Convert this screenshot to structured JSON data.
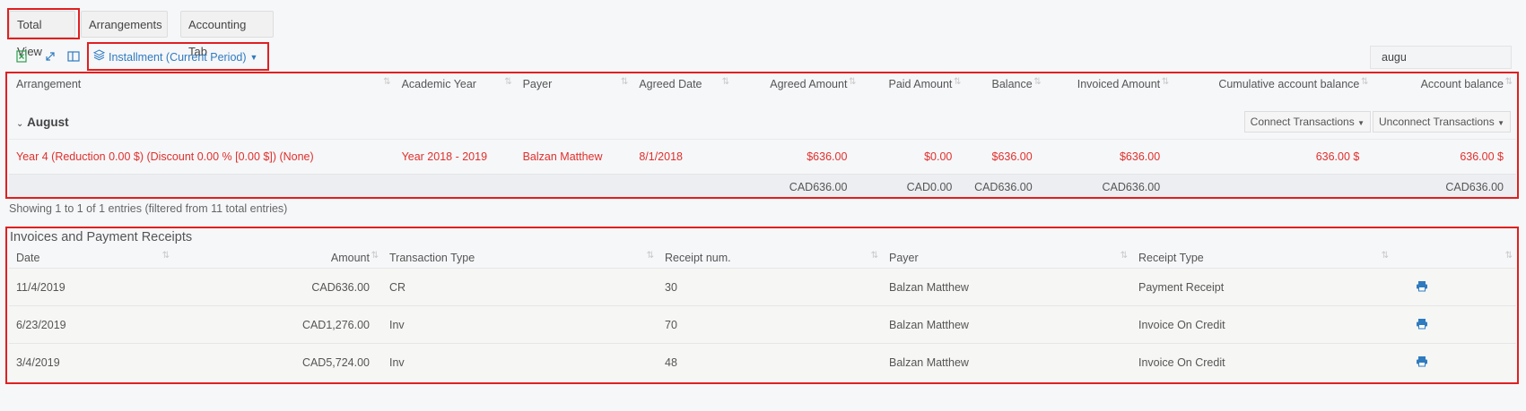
{
  "tabs": [
    {
      "label": "Total View"
    },
    {
      "label": "Arrangements"
    },
    {
      "label": "Accounting Tab"
    }
  ],
  "toolbar": {
    "excel_icon": "excel-icon",
    "expand_icon": "expand-icon",
    "columns_icon": "columns-icon",
    "view_select_label": "Installment (Current Period)"
  },
  "search": {
    "value": "augu"
  },
  "arrangements_table": {
    "headers": [
      "Arrangement",
      "Academic Year",
      "Payer",
      "Agreed Date",
      "Agreed Amount",
      "Paid Amount",
      "Balance",
      "Invoiced Amount",
      "Cumulative account balance",
      "Account balance"
    ],
    "group": {
      "label": "August",
      "connect_label": "Connect Transactions",
      "unconnect_label": "Unconnect Transactions"
    },
    "rows": [
      {
        "arrangement": "Year 4 (Reduction 0.00 $) (Discount 0.00 % [0.00 $]) (None)",
        "academic_year": "Year 2018 - 2019",
        "payer": "Balzan Matthew",
        "agreed_date": "8/1/2018",
        "agreed_amount": "$636.00",
        "paid_amount": "$0.00",
        "balance": "$636.00",
        "invoiced_amount": "$636.00",
        "cumulative_balance": "636.00 $",
        "account_balance": "636.00 $"
      }
    ],
    "totals": {
      "agreed_amount": "CAD636.00",
      "paid_amount": "CAD0.00",
      "balance": "CAD636.00",
      "invoiced_amount": "CAD636.00",
      "account_balance": "CAD636.00"
    },
    "info": "Showing 1 to 1 of 1 entries (filtered from 11 total entries)"
  },
  "receipts": {
    "title": "Invoices and Payment Receipts",
    "headers": [
      "Date",
      "Amount",
      "Transaction Type",
      "Receipt num.",
      "Payer",
      "Receipt Type"
    ],
    "rows": [
      {
        "date": "11/4/2019",
        "amount": "CAD636.00",
        "type": "CR",
        "num": "30",
        "payer": "Balzan Matthew",
        "receipt_type": "Payment Receipt"
      },
      {
        "date": "6/23/2019",
        "amount": "CAD1,276.00",
        "type": "Inv",
        "num": "70",
        "payer": "Balzan Matthew",
        "receipt_type": "Invoice On Credit"
      },
      {
        "date": "3/4/2019",
        "amount": "CAD5,724.00",
        "type": "Inv",
        "num": "48",
        "payer": "Balzan Matthew",
        "receipt_type": "Invoice On Credit"
      }
    ]
  },
  "colors": {
    "highlight": "#e02020",
    "link": "#2f7bbf",
    "overdue_text": "#e0302c"
  }
}
